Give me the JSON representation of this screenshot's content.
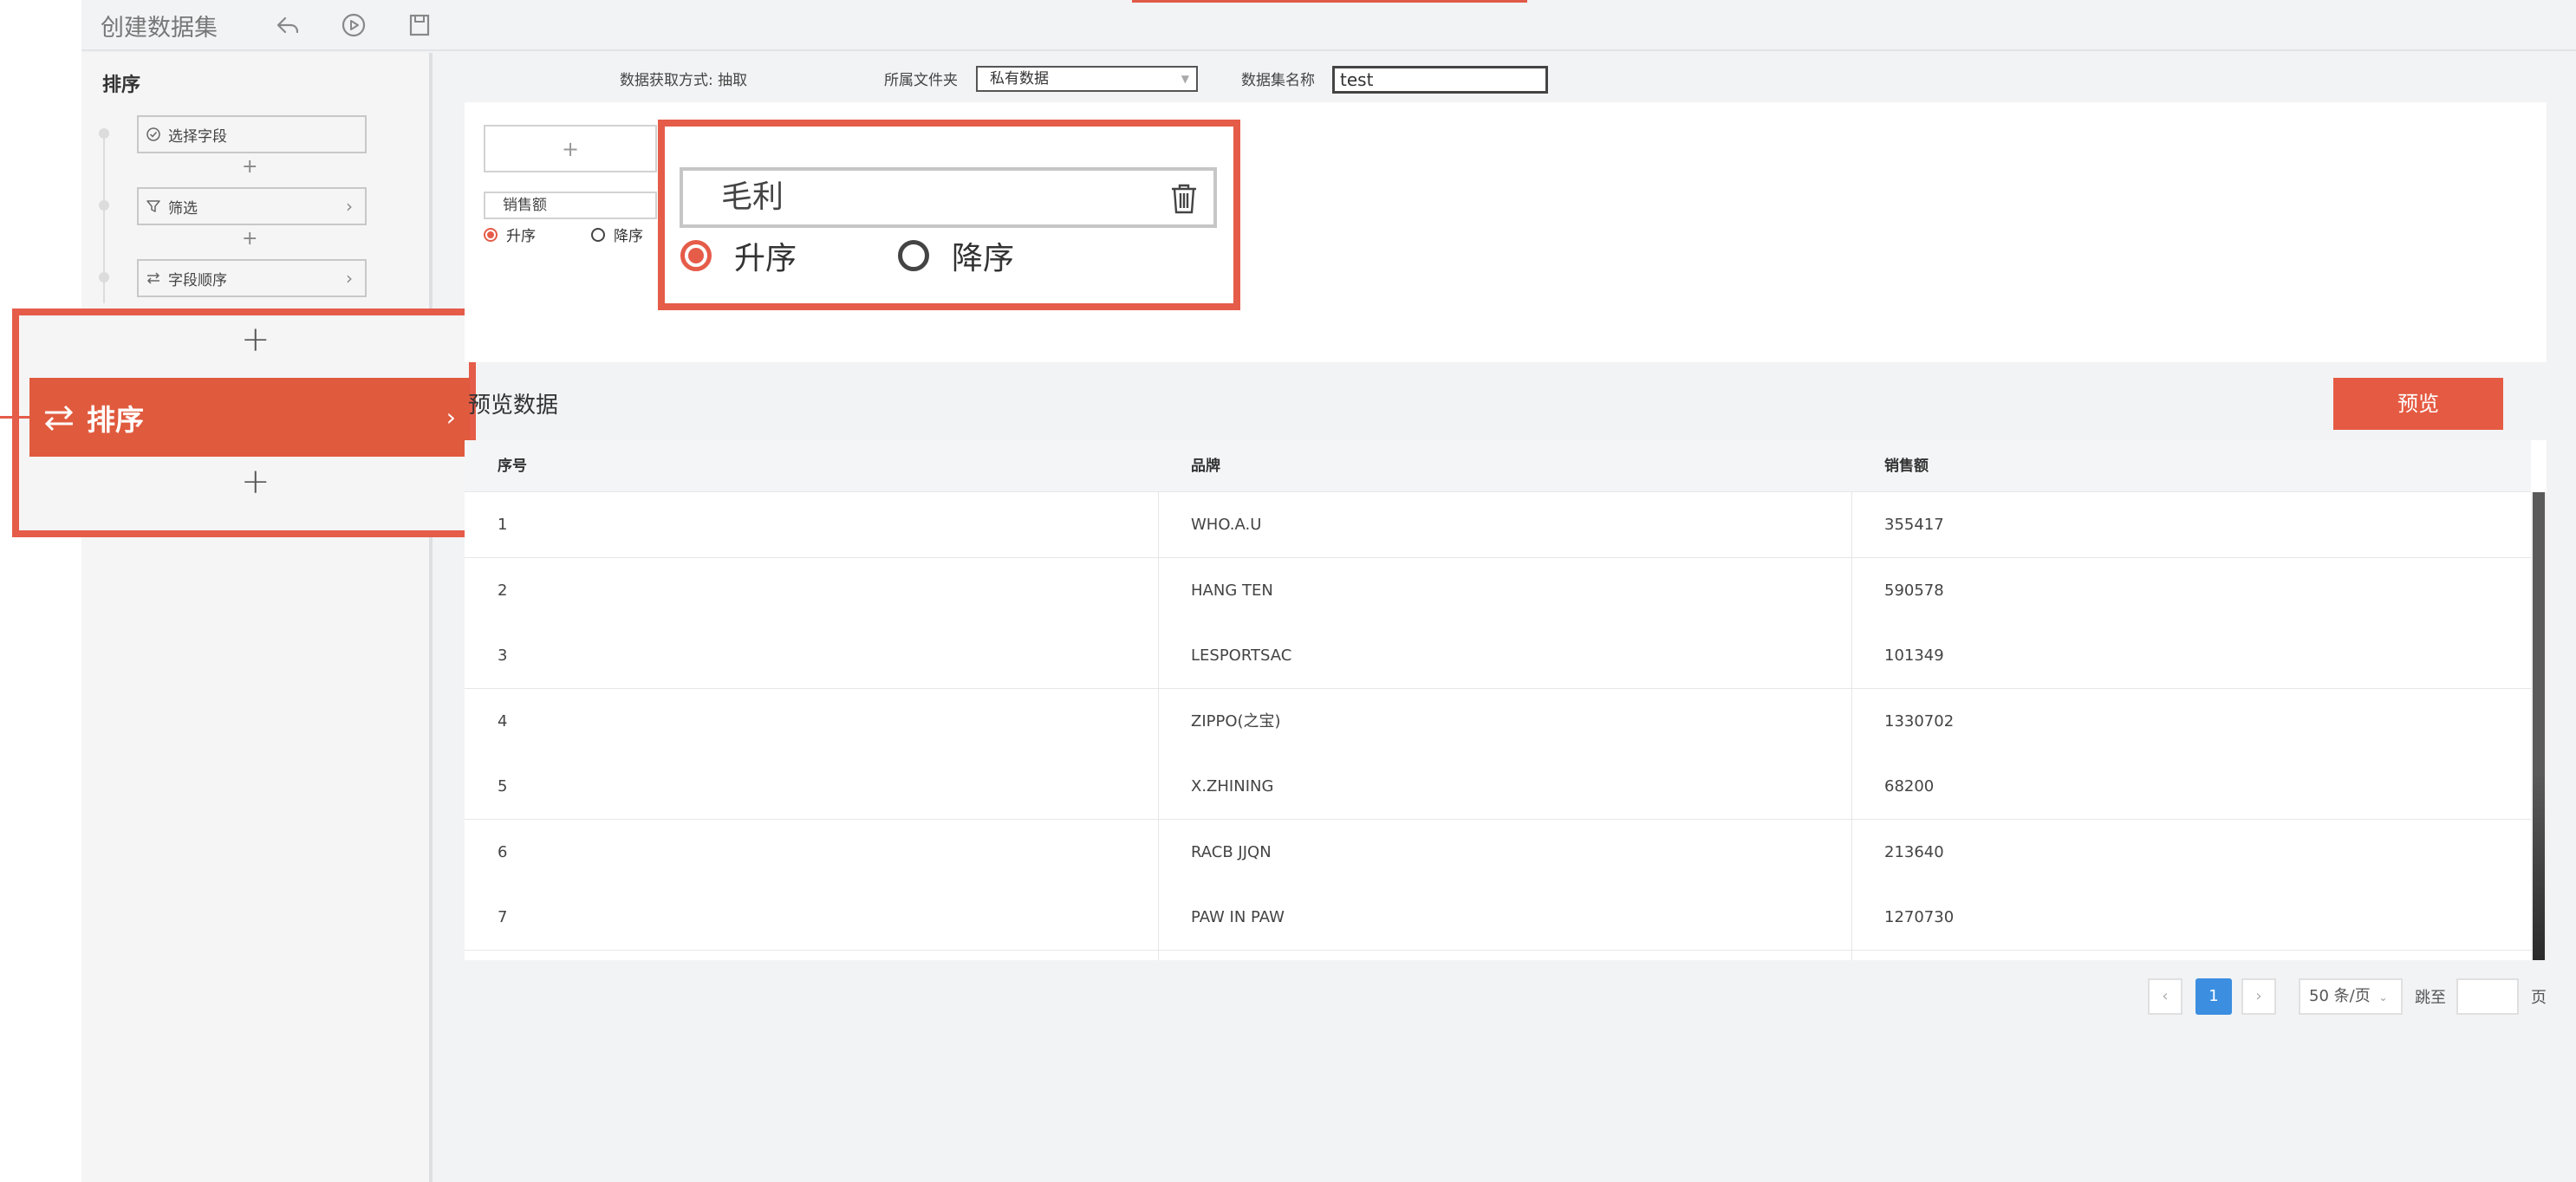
{
  "app": {
    "title": "创建数据集"
  },
  "toolbar": {
    "undo_icon": "undo-icon",
    "run_icon": "play-circle-icon",
    "save_icon": "save-icon"
  },
  "sidebar": {
    "title": "排序",
    "steps": [
      {
        "label": "选择字段",
        "icon": "check-circle-icon"
      },
      {
        "label": "筛选",
        "icon": "filter-icon"
      },
      {
        "label": "字段顺序",
        "icon": "swap-icon"
      }
    ],
    "plus": "+",
    "highlight": {
      "label": "排序",
      "plus": "+"
    }
  },
  "info": {
    "fetch_mode": "数据获取方式: 抽取",
    "folder_label": "所属文件夹",
    "folder_value": "私有数据",
    "name_label": "数据集名称",
    "name_value": "test"
  },
  "sort_config": {
    "add_symbol": "+",
    "items": [
      {
        "field": "销售额",
        "asc": "升序",
        "desc": "降序",
        "selected": "asc"
      },
      {
        "field": "毛利",
        "asc": "升序",
        "desc": "降序",
        "selected": "asc"
      }
    ]
  },
  "preview": {
    "title": "预览数据",
    "button": "预览",
    "columns": [
      "序号",
      "品牌",
      "销售额"
    ],
    "rows": [
      [
        "1",
        "WHO.A.U",
        "355417"
      ],
      [
        "2",
        "HANG TEN",
        "590578"
      ],
      [
        "3",
        "LESPORTSAC",
        "101349"
      ],
      [
        "4",
        "ZIPPO(之宝)",
        "1330702"
      ],
      [
        "5",
        "X.ZHINING",
        "68200"
      ],
      [
        "6",
        "RACB JJQN",
        "213640"
      ],
      [
        "7",
        "PAW IN PAW",
        "1270730"
      ]
    ]
  },
  "pagination": {
    "prev": "‹",
    "current": "1",
    "next": "›",
    "page_size": "50 条/页",
    "goto_label": "跳至",
    "page_suffix": "页"
  },
  "colors": {
    "accent": "#e55c49",
    "primary_blue": "#3b8ee0"
  }
}
